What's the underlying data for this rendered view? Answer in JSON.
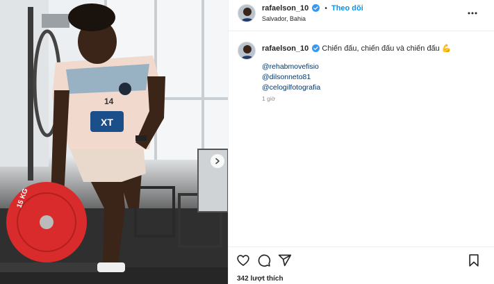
{
  "post": {
    "username": "rafaelson_10",
    "follow_label": "Theo dõi",
    "location": "Salvador, Bahia",
    "dot": "•"
  },
  "caption": {
    "username": "rafaelson_10",
    "text": "Chiến đấu, chiến đấu và chiến đấu",
    "emoji": "💪",
    "tags": [
      "@rehabmovefisio",
      "@dilsonneto81",
      "@celogilfotografia"
    ],
    "time": "1 giờ"
  },
  "photo": {
    "shirt_number": "14",
    "shirt_logo": "XT",
    "plate_text": "15 KG"
  },
  "footer": {
    "likes": "342 lượt thích"
  },
  "colors": {
    "accent": "#0095f6",
    "verified": "#3897f0",
    "tag": "#00376b",
    "plate": "#d92b2b"
  }
}
